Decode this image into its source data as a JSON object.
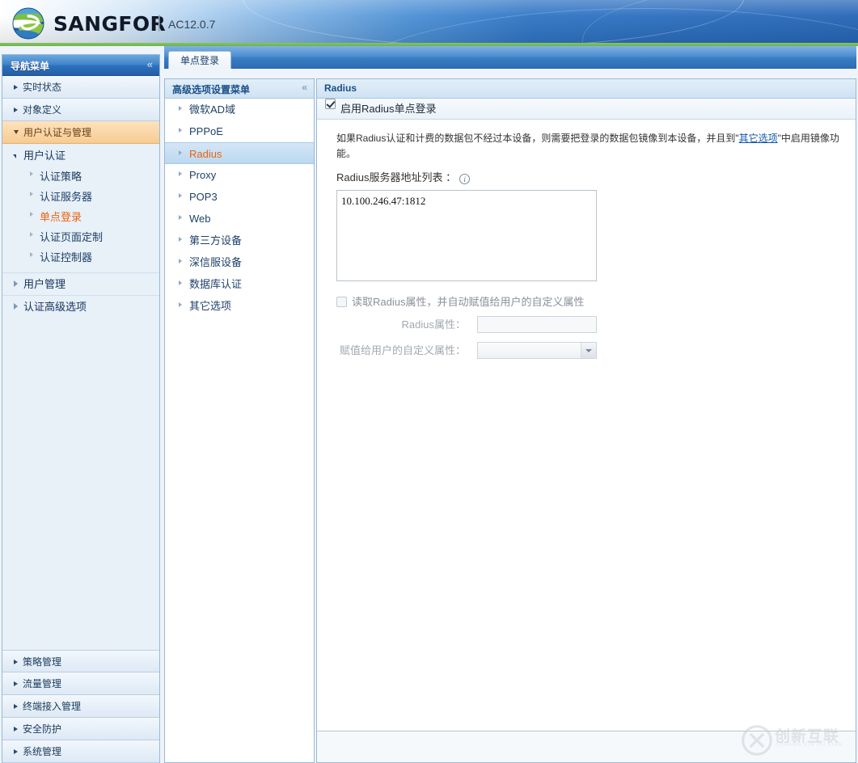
{
  "header": {
    "brand": "SANGFOR",
    "separator": "|",
    "version": "AC12.0.7",
    "logo_icon": "globe-icon",
    "colors": {
      "blue_dark": "#2565b6",
      "blue_light": "#7fb3e3",
      "green_strip": "#6eb24c"
    }
  },
  "left_nav": {
    "title": "导航菜单",
    "collapse_icon": "«",
    "top_items": [
      {
        "label": "实时状态",
        "active": false
      },
      {
        "label": "对象定义",
        "active": false
      },
      {
        "label": "用户认证与管理",
        "active": true
      }
    ],
    "group": {
      "label": "用户认证",
      "items": [
        {
          "label": "认证策略",
          "selected": false
        },
        {
          "label": "认证服务器",
          "selected": false
        },
        {
          "label": "单点登录",
          "selected": true
        },
        {
          "label": "认证页面定制",
          "selected": false
        },
        {
          "label": "认证控制器",
          "selected": false
        }
      ]
    },
    "group2": [
      {
        "label": "用户管理"
      },
      {
        "label": "认证高级选项"
      }
    ],
    "bottom_items": [
      {
        "label": "策略管理"
      },
      {
        "label": "流量管理"
      },
      {
        "label": "终端接入管理"
      },
      {
        "label": "安全防护"
      },
      {
        "label": "系统管理"
      }
    ],
    "selected_color": "#e8650f"
  },
  "tabs": [
    {
      "label": "单点登录",
      "active": true
    }
  ],
  "menu2": {
    "title": "高级选项设置菜单",
    "collapse_icon": "«",
    "items": [
      {
        "label": "微软AD域",
        "selected": false
      },
      {
        "label": "PPPoE",
        "selected": false
      },
      {
        "label": "Radius",
        "selected": true
      },
      {
        "label": "Proxy",
        "selected": false
      },
      {
        "label": "POP3",
        "selected": false
      },
      {
        "label": "Web",
        "selected": false
      },
      {
        "label": "第三方设备",
        "selected": false
      },
      {
        "label": "深信服设备",
        "selected": false
      },
      {
        "label": "数据库认证",
        "selected": false
      },
      {
        "label": "其它选项",
        "selected": false
      }
    ]
  },
  "content": {
    "title": "Radius",
    "enable_checkbox": {
      "label": "启用Radius单点登录",
      "checked": true
    },
    "description_before": "如果Radius认证和计费的数据包不经过本设备，则需要把登录的数据包镜像到本设备，并且到\"",
    "description_link": "其它选项",
    "description_after": "\"中启用镜像功能。",
    "server_list_label": "Radius服务器地址列表 ：",
    "info_icon": "info-icon",
    "server_list_value": "10.100.246.47:1812",
    "attr_checkbox": {
      "label": "读取Radius属性，并自动赋值给用户的自定义属性",
      "checked": false
    },
    "attr_field_label": "Radius属性：",
    "attr_field_value": "",
    "attr_field_placeholder": "",
    "assign_field_label": "赋值给用户的自定义属性：",
    "assign_field_value": ""
  },
  "watermark": {
    "text": "创新互联",
    "subtext": "CHUANG XIN HU LIAN",
    "logo_icon": "cx-circle-icon"
  }
}
